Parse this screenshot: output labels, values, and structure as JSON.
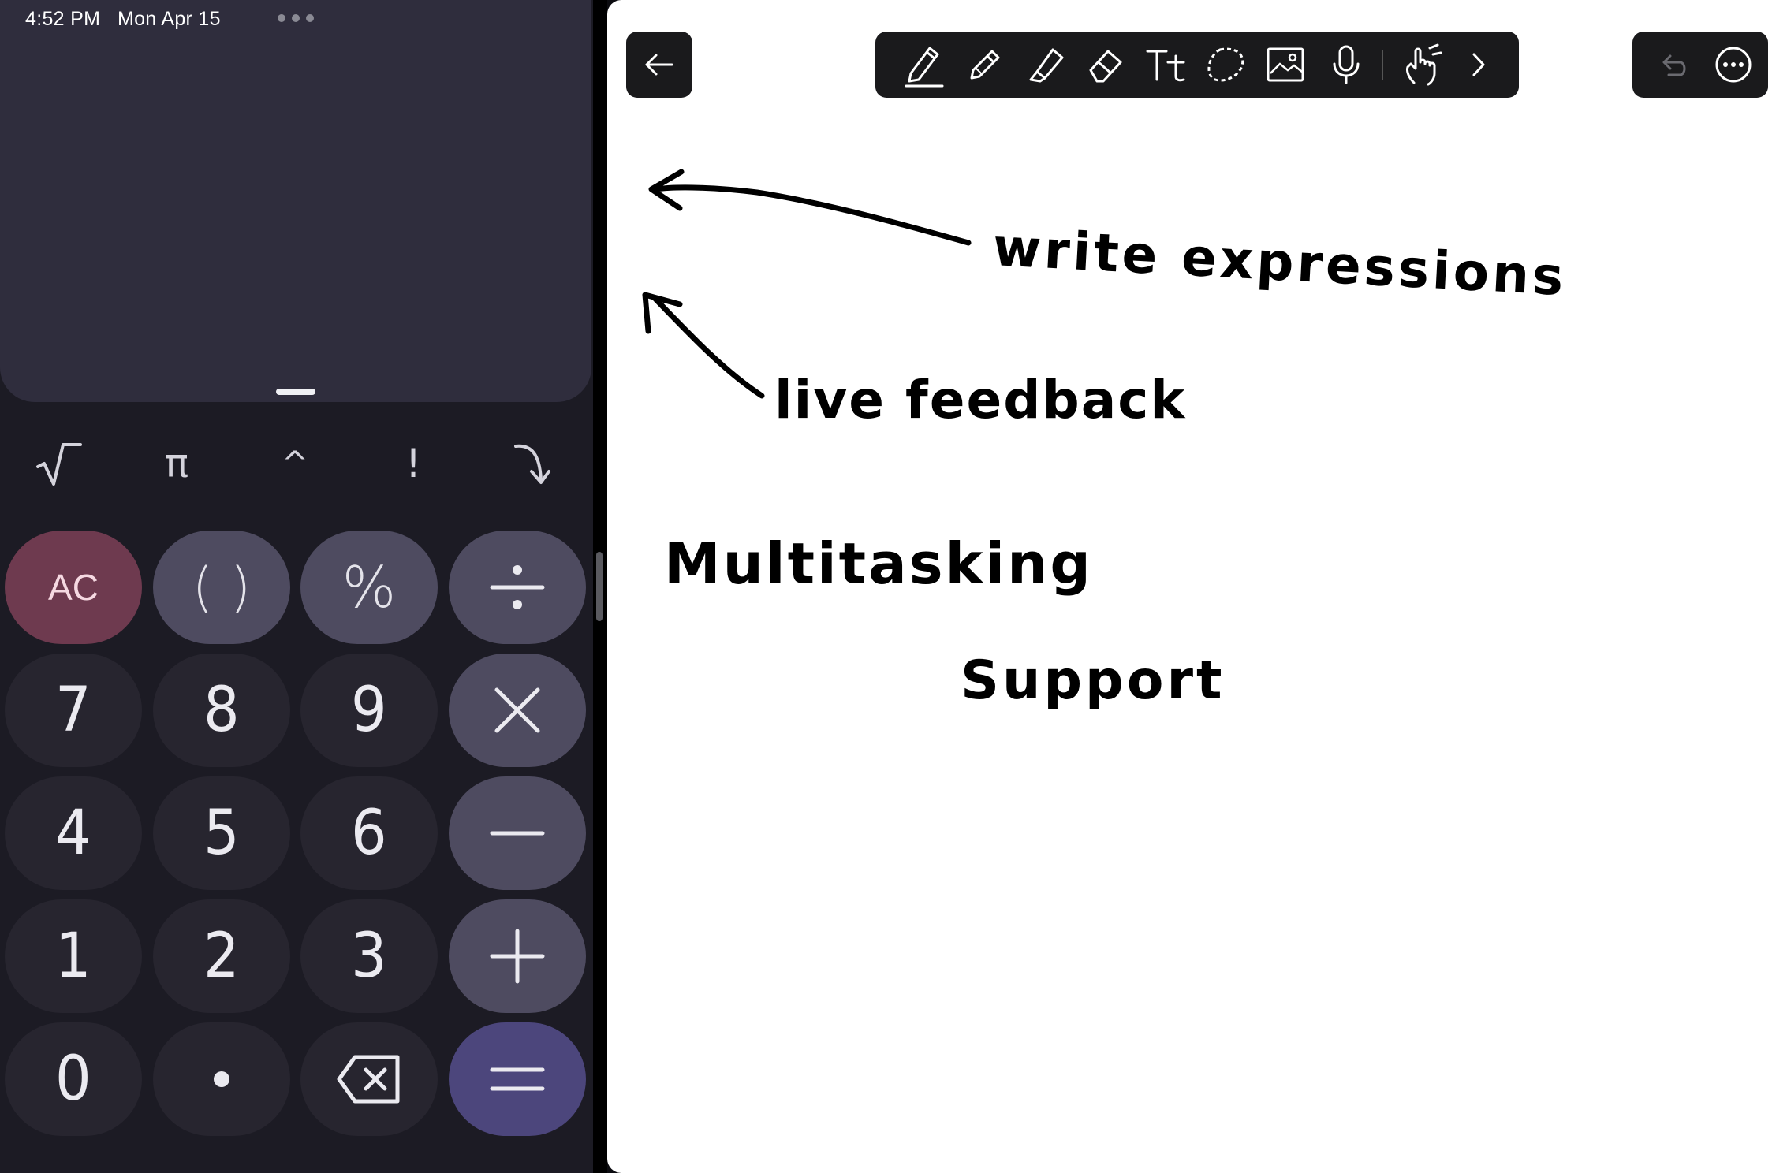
{
  "status_bar": {
    "time": "4:52 PM",
    "date": "Mon Apr 15"
  },
  "calculator": {
    "function_keys": [
      {
        "name": "sqrt",
        "icon": "square-root-icon"
      },
      {
        "name": "pi",
        "label": "π"
      },
      {
        "name": "power",
        "label": "^"
      },
      {
        "name": "factorial",
        "label": "!"
      },
      {
        "name": "insert-result",
        "icon": "curved-arrow-down-icon"
      }
    ],
    "keys": {
      "ac": "AC",
      "parens": "( )",
      "percent": "%",
      "seven": "7",
      "eight": "8",
      "nine": "9",
      "four": "4",
      "five": "5",
      "six": "6",
      "one": "1",
      "two": "2",
      "three": "3",
      "zero": "0"
    },
    "colors": {
      "background": "#1c1b24",
      "display": "#2f2d3d",
      "digit_key": "#27252f",
      "operator_key": "#4e4b60",
      "clear_key": "#6e3a4f",
      "equals_key": "#4c467c"
    }
  },
  "notes": {
    "toolbar_tools": [
      "pen-icon",
      "pencil-icon",
      "highlighter-icon",
      "eraser-icon",
      "text-tool-icon",
      "lasso-icon",
      "image-icon",
      "microphone-icon",
      "touch-hand-icon",
      "chevron-right-icon"
    ],
    "selected_tool": "pen-icon",
    "handwriting": {
      "line1": "write expressions",
      "line2": "live feedback",
      "line3": "Multitasking",
      "line4": "Support"
    }
  }
}
